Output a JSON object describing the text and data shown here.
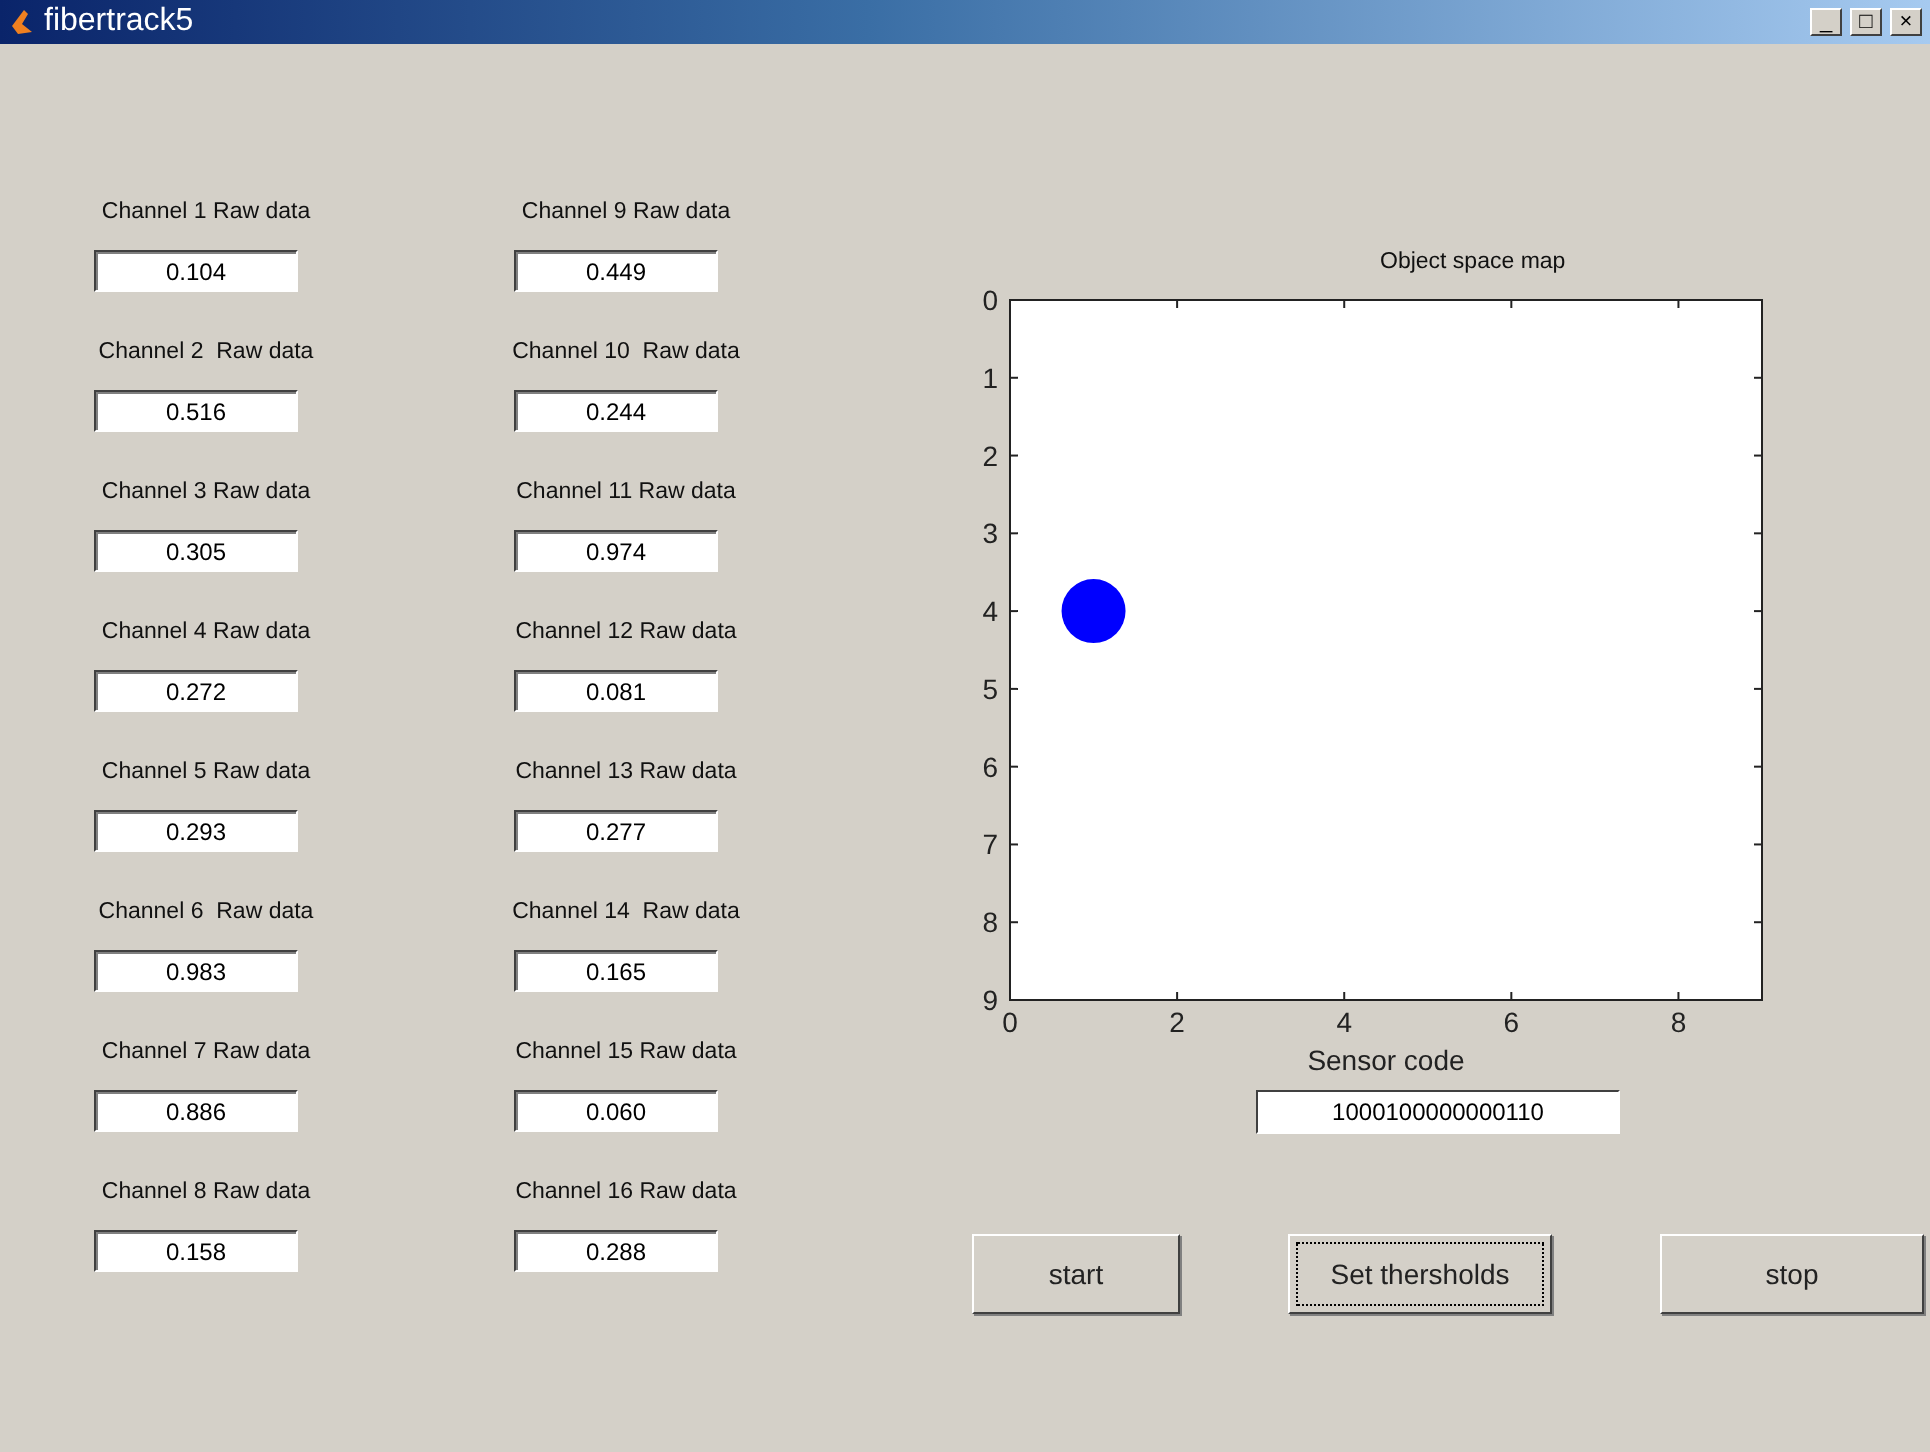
{
  "window": {
    "title": "fibertrack5",
    "controls": [
      "_",
      "□",
      "×"
    ]
  },
  "channels": [
    {
      "label": "Channel 1 Raw data",
      "value": "0.104"
    },
    {
      "label": "Channel 2  Raw data",
      "value": "0.516"
    },
    {
      "label": "Channel 3 Raw data",
      "value": "0.305"
    },
    {
      "label": "Channel 4 Raw data",
      "value": "0.272"
    },
    {
      "label": "Channel 5 Raw data",
      "value": "0.293"
    },
    {
      "label": "Channel 6  Raw data",
      "value": "0.983"
    },
    {
      "label": "Channel 7 Raw data",
      "value": "0.886"
    },
    {
      "label": "Channel 8 Raw data",
      "value": "0.158"
    },
    {
      "label": "Channel 9 Raw data",
      "value": "0.449"
    },
    {
      "label": "Channel 10  Raw data",
      "value": "0.244"
    },
    {
      "label": "Channel 11 Raw data",
      "value": "0.974"
    },
    {
      "label": "Channel 12 Raw data",
      "value": "0.081"
    },
    {
      "label": "Channel 13 Raw data",
      "value": "0.277"
    },
    {
      "label": "Channel 14  Raw data",
      "value": "0.165"
    },
    {
      "label": "Channel 15 Raw data",
      "value": "0.060"
    },
    {
      "label": "Channel 16 Raw data",
      "value": "0.288"
    }
  ],
  "map": {
    "chart_data": {
      "type": "scatter",
      "title": "Object space map",
      "xlabel": "Sensor code",
      "x": [
        1
      ],
      "series": [
        {
          "color": "#0000ff",
          "values": [
            4
          ]
        }
      ],
      "xlim": [
        0,
        9
      ],
      "ylim": [
        9,
        0
      ],
      "xticks": [
        0,
        2,
        4,
        6,
        8
      ],
      "yticks": [
        0,
        1,
        2,
        3,
        4,
        5,
        6,
        7,
        8,
        9
      ]
    },
    "sensor_code": "1000100000000110"
  },
  "buttons": [
    {
      "label": "start",
      "focused": false
    },
    {
      "label": "Set thersholds",
      "focused": true
    },
    {
      "label": "stop",
      "focused": false
    }
  ]
}
